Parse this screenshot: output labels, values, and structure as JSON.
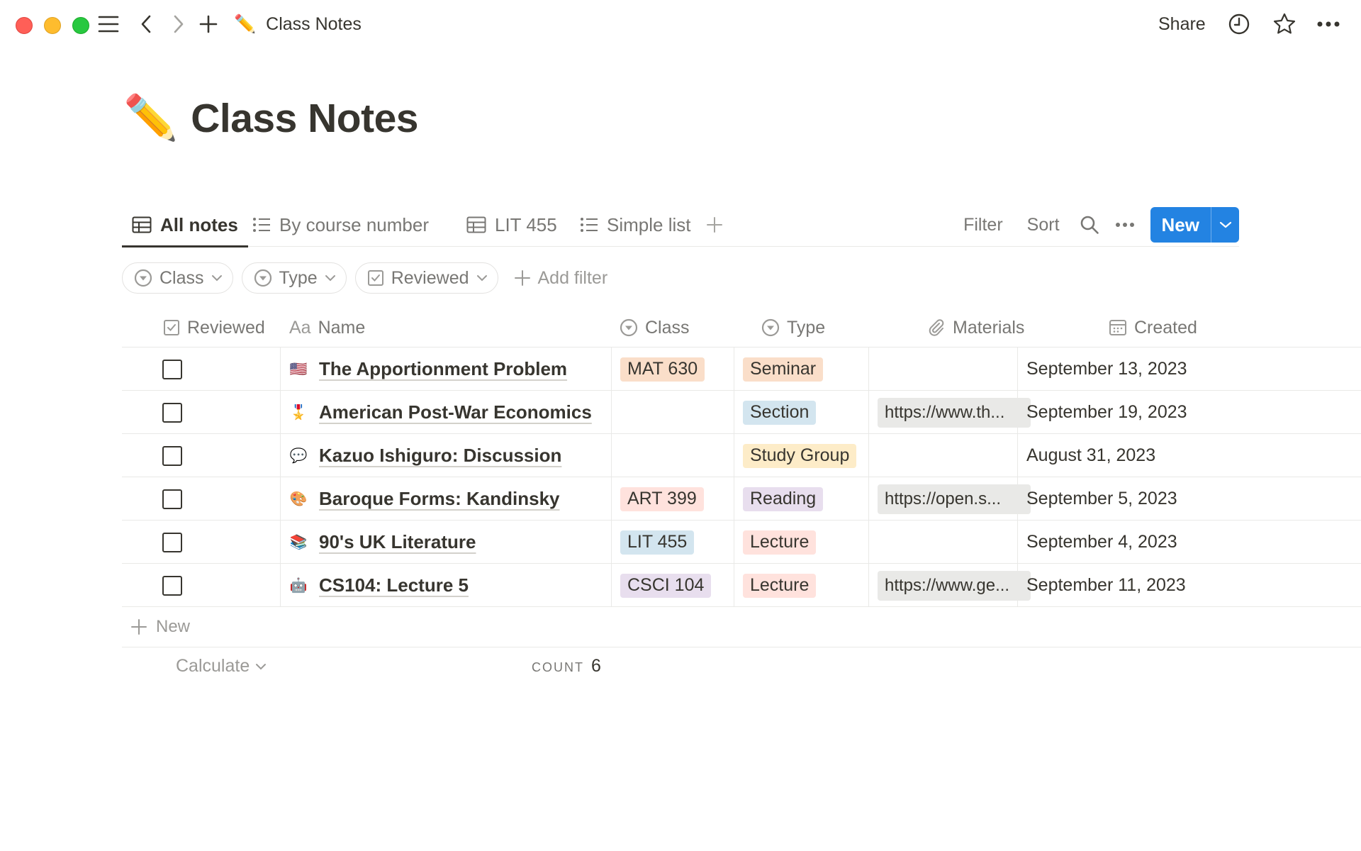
{
  "topbar": {
    "title_icon": "✏️",
    "title": "Class Notes",
    "share_label": "Share"
  },
  "page": {
    "emoji": "✏️",
    "title": "Class Notes"
  },
  "views": {
    "tabs": [
      {
        "label": "All notes",
        "icon": "table-icon",
        "active": true
      },
      {
        "label": "By course number",
        "icon": "list-icon",
        "active": false
      },
      {
        "label": "LIT 455",
        "icon": "table-icon",
        "active": false
      },
      {
        "label": "Simple list",
        "icon": "list-icon",
        "active": false
      }
    ],
    "filter_label": "Filter",
    "sort_label": "Sort",
    "new_label": "New"
  },
  "filters": {
    "chips": [
      "Class",
      "Type",
      "Reviewed"
    ],
    "add_filter_label": "Add filter"
  },
  "table": {
    "columns": {
      "reviewed": "Reviewed",
      "name_prefix": "Aa",
      "name": "Name",
      "class": "Class",
      "type": "Type",
      "materials": "Materials",
      "created": "Created"
    },
    "rows": [
      {
        "icon": "🇺🇸",
        "name": "The Apportionment Problem",
        "class": "MAT 630",
        "type": "Seminar",
        "materials": "",
        "created": "September 13, 2023"
      },
      {
        "icon": "🎖️",
        "name": "American Post-War Economics",
        "class": "",
        "type": "Section",
        "materials": "https://www.th...",
        "created": "September 19, 2023"
      },
      {
        "icon": "💬",
        "name": "Kazuo Ishiguro: Discussion",
        "class": "",
        "type": "Study Group",
        "materials": "",
        "created": "August 31, 2023"
      },
      {
        "icon": "🎨",
        "name": "Baroque Forms: Kandinsky",
        "class": "ART 399",
        "type": "Reading",
        "materials": "https://open.s...",
        "created": "September 5, 2023"
      },
      {
        "icon": "📚",
        "name": "90's UK Literature",
        "class": "LIT 455",
        "type": "Lecture",
        "materials": "",
        "created": "September 4, 2023"
      },
      {
        "icon": "🤖",
        "name": "CS104: Lecture 5",
        "class": "CSCI 104",
        "type": "Lecture",
        "materials": "https://www.ge...",
        "created": "September 11, 2023"
      }
    ],
    "new_row_label": "New",
    "calculate_label": "Calculate",
    "count_label": "COUNT",
    "count_value": "6"
  },
  "colors": {
    "accent_blue": "#2383e2",
    "tag_mat": "#fadec9",
    "tag_art": "#ffe2dd",
    "tag_lit": "#d3e5ef",
    "tag_csci": "#e8deee",
    "tag_seminar": "#fadec9",
    "tag_section": "#d3e5ef",
    "tag_study_group": "#fdecc8",
    "tag_reading": "#e8deee",
    "tag_lecture": "#ffe2dd"
  }
}
